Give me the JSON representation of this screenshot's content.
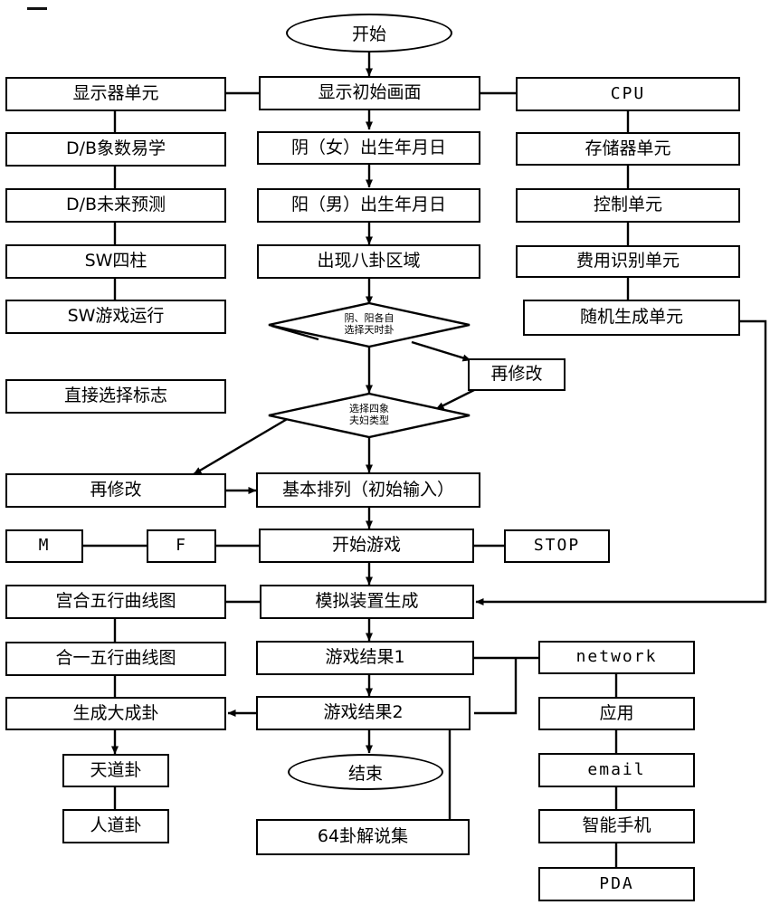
{
  "diagram": {
    "type": "flowchart",
    "title": "",
    "terminals": [
      {
        "id": "start",
        "label": "开始"
      },
      {
        "id": "end",
        "label": "结束"
      }
    ],
    "decisions": [
      {
        "id": "d1",
        "line1": "阴、阳各自",
        "line2": "选择天时卦"
      },
      {
        "id": "d2",
        "line1": "选择四象",
        "line2": "夫妇类型"
      }
    ],
    "left_column": [
      {
        "id": "l1",
        "label": "显示器单元"
      },
      {
        "id": "l2",
        "label": "D/B象数易学"
      },
      {
        "id": "l3",
        "label": "D/B未来预测"
      },
      {
        "id": "l4",
        "label": "SW四柱"
      },
      {
        "id": "l5",
        "label": "SW游戏运行"
      },
      {
        "id": "l6",
        "label": "直接选择标志"
      },
      {
        "id": "l7",
        "label": "再修改"
      },
      {
        "id": "l8",
        "label": "宫合五行曲线图"
      },
      {
        "id": "l9",
        "label": "合一五行曲线图"
      },
      {
        "id": "l10",
        "label": "生成大成卦"
      },
      {
        "id": "l11",
        "label": "天道卦"
      },
      {
        "id": "l12",
        "label": "人道卦"
      }
    ],
    "center_column": [
      {
        "id": "c1",
        "label": "显示初始画面"
      },
      {
        "id": "c2",
        "label": "阴（女）出生年月日"
      },
      {
        "id": "c3",
        "label": "阳（男）出生年月日"
      },
      {
        "id": "c4",
        "label": "出现八卦区域"
      },
      {
        "id": "c5",
        "label": "再修改"
      },
      {
        "id": "c6",
        "label": "基本排列（初始输入）"
      },
      {
        "id": "c7",
        "label": "开始游戏"
      },
      {
        "id": "c8",
        "label": "模拟装置生成"
      },
      {
        "id": "c9",
        "label": "游戏结果1"
      },
      {
        "id": "c10",
        "label": "游戏结果2"
      },
      {
        "id": "c11",
        "label": "64卦解说集"
      }
    ],
    "right_column": [
      {
        "id": "r1",
        "label": "CPU"
      },
      {
        "id": "r2",
        "label": "存储器单元"
      },
      {
        "id": "r3",
        "label": "控制单元"
      },
      {
        "id": "r4",
        "label": "费用识别单元"
      },
      {
        "id": "r5",
        "label": "随机生成单元"
      },
      {
        "id": "r6",
        "label": "network"
      },
      {
        "id": "r7",
        "label": "应用"
      },
      {
        "id": "r8",
        "label": "email"
      },
      {
        "id": "r9",
        "label": "智能手机"
      },
      {
        "id": "r10",
        "label": "PDA"
      }
    ],
    "small_nodes": [
      {
        "id": "m",
        "label": "M"
      },
      {
        "id": "f",
        "label": "F"
      },
      {
        "id": "stop",
        "label": "STOP"
      }
    ],
    "colors": {
      "line": "#000000",
      "fill": "#ffffff",
      "text": "#000000"
    }
  }
}
